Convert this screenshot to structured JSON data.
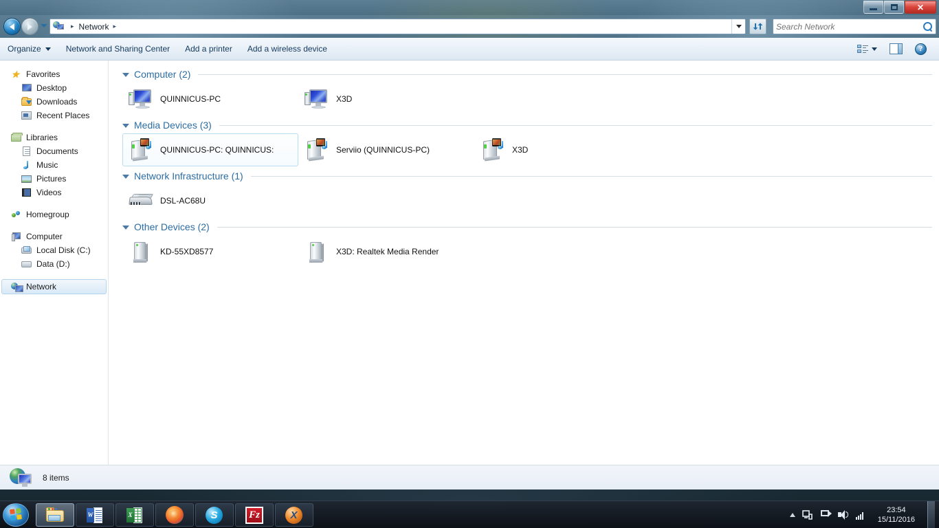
{
  "window": {
    "title_bar": {
      "minimize_label": "Minimize",
      "maximize_label": "Maximize",
      "close_label": "✕"
    }
  },
  "address_bar": {
    "back_label": "Back",
    "forward_label": "Forward",
    "history_label": "Recent pages",
    "crumb_icon": "network-icon",
    "crumb_text": "Network",
    "crumb_separator": "▸",
    "trailing_separator": "▸",
    "dropdown_label": "Previous locations",
    "refresh_label": "↻"
  },
  "search": {
    "placeholder": "Search Network",
    "value": ""
  },
  "command_bar": {
    "organize_label": "Organize",
    "items": [
      {
        "label": "Network and Sharing Center"
      },
      {
        "label": "Add a printer"
      },
      {
        "label": "Add a wireless device"
      }
    ],
    "view_label": "Change your view",
    "preview_label": "Show the preview pane",
    "help_label": "?"
  },
  "sidebar": {
    "groups": [
      {
        "header": {
          "label": "Favorites",
          "icon": "star-icon"
        },
        "items": [
          {
            "label": "Desktop",
            "icon": "desktop-icon"
          },
          {
            "label": "Downloads",
            "icon": "downloads-folder-icon"
          },
          {
            "label": "Recent Places",
            "icon": "recent-places-icon"
          }
        ]
      },
      {
        "header": {
          "label": "Libraries",
          "icon": "libraries-icon"
        },
        "items": [
          {
            "label": "Documents",
            "icon": "document-icon"
          },
          {
            "label": "Music",
            "icon": "music-note-icon"
          },
          {
            "label": "Pictures",
            "icon": "picture-icon"
          },
          {
            "label": "Videos",
            "icon": "video-film-icon"
          }
        ]
      },
      {
        "header": {
          "label": "Homegroup",
          "icon": "homegroup-icon"
        },
        "items": []
      },
      {
        "header": {
          "label": "Computer",
          "icon": "computer-icon"
        },
        "items": [
          {
            "label": "Local Disk (C:)",
            "icon": "windows-drive-icon"
          },
          {
            "label": "Data (D:)",
            "icon": "drive-icon"
          }
        ]
      },
      {
        "header": {
          "label": "Network",
          "icon": "network-icon",
          "selected": true
        },
        "items": []
      }
    ]
  },
  "main": {
    "groups": [
      {
        "title": "Computer (2)",
        "icon_type": "pc",
        "items": [
          {
            "label": "QUINNICUS-PC",
            "selected": false
          },
          {
            "label": "X3D",
            "selected": false
          }
        ]
      },
      {
        "title": "Media Devices (3)",
        "icon_type": "media",
        "items": [
          {
            "label": "QUINNICUS-PC: QUINNICUS:",
            "selected": true
          },
          {
            "label": "Serviio (QUINNICUS-PC)",
            "selected": false
          },
          {
            "label": "X3D",
            "selected": false
          }
        ]
      },
      {
        "title": "Network Infrastructure (1)",
        "icon_type": "router",
        "items": [
          {
            "label": "DSL-AC68U",
            "selected": false
          }
        ]
      },
      {
        "title": "Other Devices (2)",
        "icon_type": "device",
        "items": [
          {
            "label": "KD-55XD8577",
            "selected": false
          },
          {
            "label": "X3D: Realtek Media Render",
            "selected": false
          }
        ]
      }
    ]
  },
  "status_bar": {
    "icon": "network-computer-icon",
    "text": "8 items"
  },
  "taskbar": {
    "start_label": "Start",
    "buttons": [
      {
        "name": "windows-explorer",
        "icon": "folder-icon",
        "active": true
      },
      {
        "name": "microsoft-word",
        "icon": "word-icon",
        "glyph": "W",
        "active": false
      },
      {
        "name": "microsoft-excel",
        "icon": "excel-icon",
        "glyph": "X",
        "active": false
      },
      {
        "name": "firefox",
        "icon": "firefox-icon",
        "active": false
      },
      {
        "name": "skype",
        "icon": "skype-icon",
        "glyph": "S",
        "active": false
      },
      {
        "name": "filezilla",
        "icon": "filezilla-icon",
        "glyph": "Fz",
        "active": false
      },
      {
        "name": "x-app",
        "icon": "x-orb-icon",
        "glyph": "X",
        "active": false
      }
    ],
    "tray": {
      "show_hidden_label": "Show hidden icons",
      "action_center_label": "action-center-icon",
      "network_label": "network-tray-icon",
      "volume_label": "volume-icon",
      "signal_label": "signal-bars-icon",
      "time": "23:54",
      "date": "15/11/2016"
    }
  },
  "colors": {
    "group_title": "#2b6ca3",
    "selection_border": "#b9dcf2",
    "sidebar_selected_bg": "#d9e9f7",
    "close_button": "#d9453c"
  }
}
